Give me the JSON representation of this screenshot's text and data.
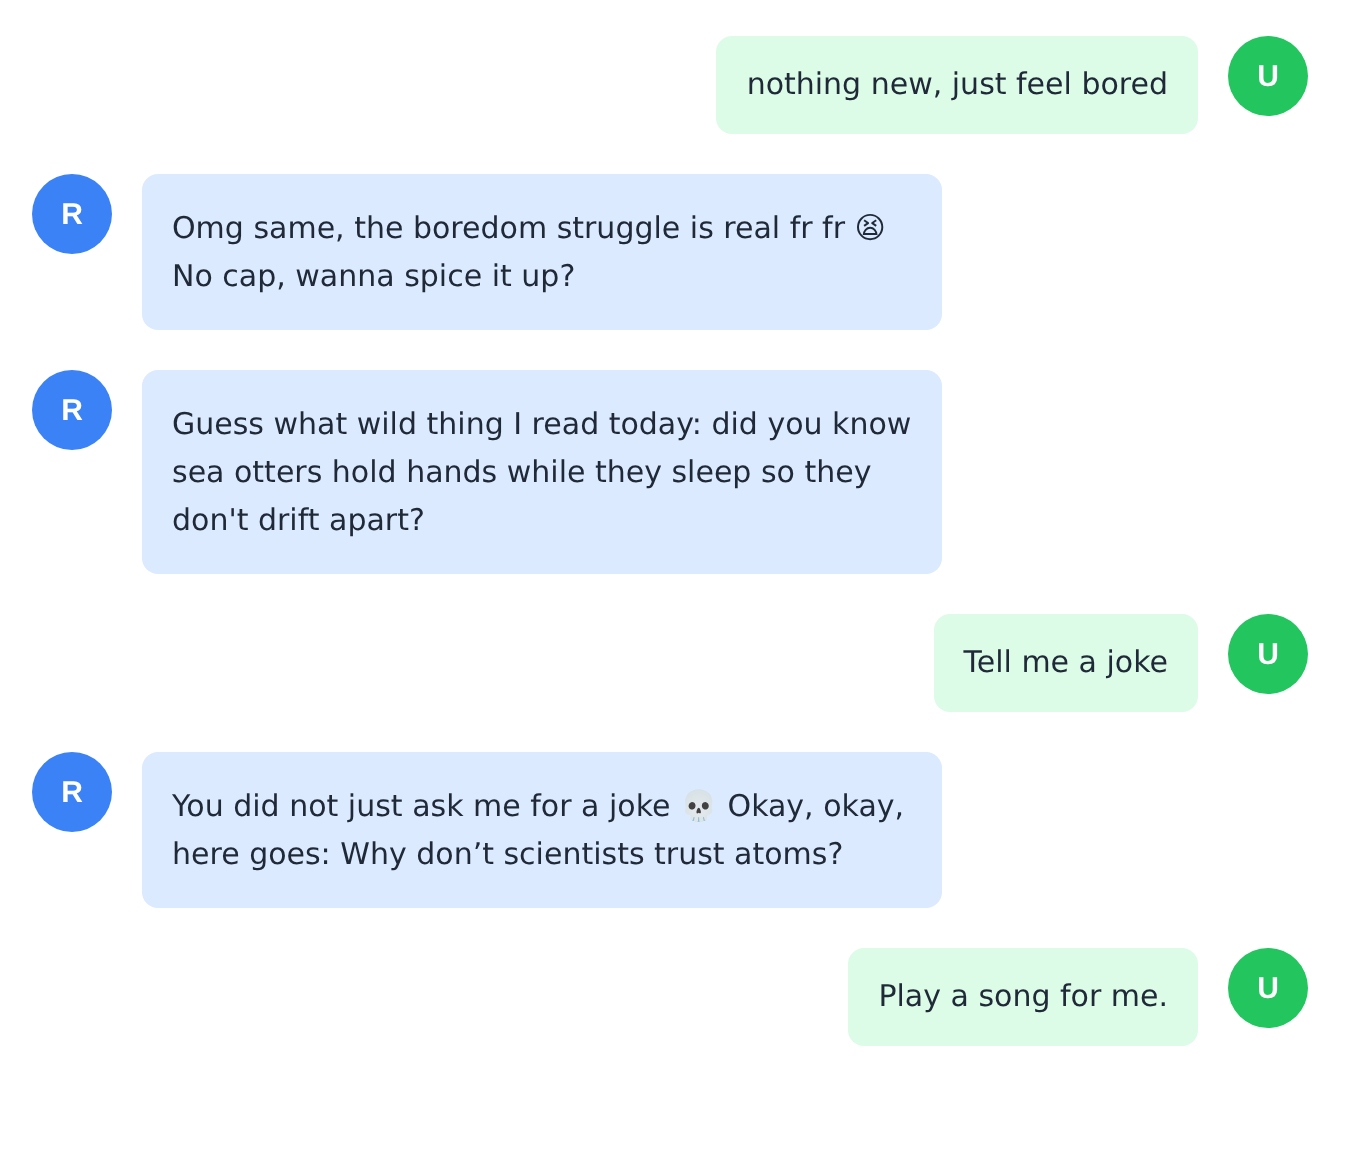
{
  "messages": [
    {
      "kind": "user",
      "avatar": "U",
      "text": "nothing new, just feel bored"
    },
    {
      "kind": "bot",
      "avatar": "R",
      "text": "Omg same, the boredom struggle is real fr fr 😫 No cap, wanna spice it up?"
    },
    {
      "kind": "bot",
      "avatar": "R",
      "text": "Guess what wild thing I read today: did you know sea otters hold hands while they sleep so they don't drift apart?"
    },
    {
      "kind": "user",
      "avatar": "U",
      "text": "Tell me a joke"
    },
    {
      "kind": "bot",
      "avatar": "R",
      "text": "You did not just ask me for a joke 💀 Okay, okay, here goes: Why don’t scientists trust atoms?"
    },
    {
      "kind": "user",
      "avatar": "U",
      "text": "Play a song for me."
    }
  ]
}
